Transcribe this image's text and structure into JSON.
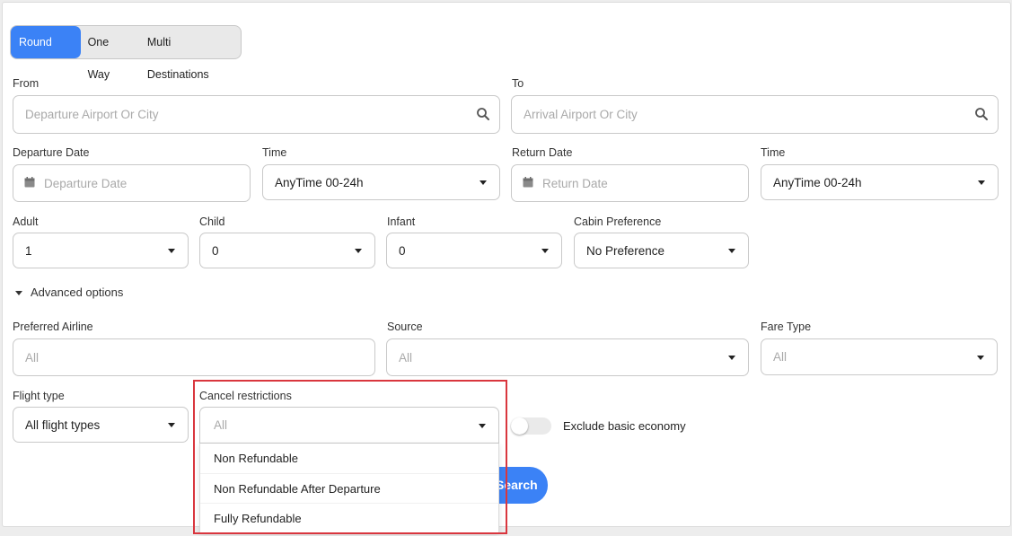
{
  "trip_types": [
    {
      "label": "Round Trip",
      "active": true
    },
    {
      "label": "One Way",
      "active": false
    },
    {
      "label": "Multi Destinations",
      "active": false
    }
  ],
  "route": {
    "from_label": "From",
    "from_placeholder": "Departure Airport Or City",
    "to_label": "To",
    "to_placeholder": "Arrival Airport Or City"
  },
  "dates": {
    "departure_label": "Departure Date",
    "departure_placeholder": "Departure Date",
    "departure_time_label": "Time",
    "departure_time_value": "AnyTime 00-24h",
    "return_label": "Return Date",
    "return_placeholder": "Return Date",
    "return_time_label": "Time",
    "return_time_value": "AnyTime 00-24h"
  },
  "passengers": {
    "adult_label": "Adult",
    "adult_value": "1",
    "child_label": "Child",
    "child_value": "0",
    "infant_label": "Infant",
    "infant_value": "0",
    "cabin_label": "Cabin Preference",
    "cabin_value": "No Preference"
  },
  "advanced_label": "Advanced options",
  "advanced": {
    "airline_label": "Preferred Airline",
    "airline_placeholder": "All",
    "source_label": "Source",
    "source_placeholder": "All",
    "fare_label": "Fare Type",
    "fare_placeholder": "All",
    "flight_type_label": "Flight type",
    "flight_type_value": "All flight types",
    "cancel_label": "Cancel restrictions",
    "cancel_placeholder": "All",
    "cancel_options": [
      "Non Refundable",
      "Non Refundable After Departure",
      "Fully Refundable"
    ],
    "exclude_basic_label": "Exclude basic economy"
  },
  "search_label": "Search",
  "colors": {
    "accent": "#3b82f6",
    "highlight": "#d9363e"
  }
}
